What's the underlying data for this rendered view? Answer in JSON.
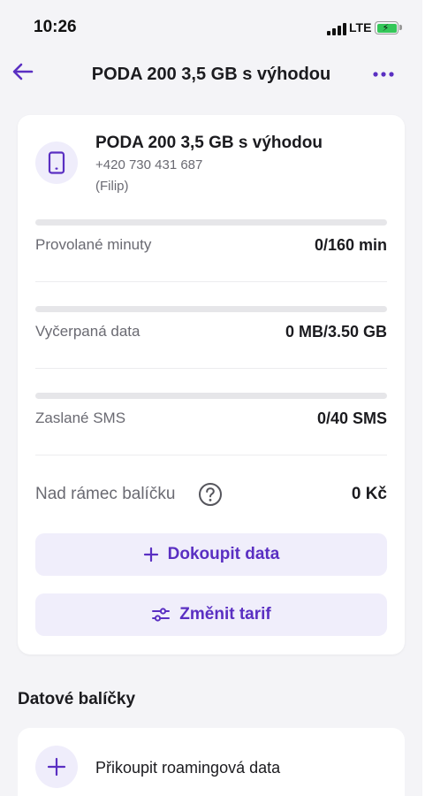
{
  "status_bar": {
    "time": "10:26",
    "network": "LTE",
    "battery_charging": true
  },
  "header": {
    "title": "PODA 200 3,5 GB s výhodou",
    "back_icon": "arrow-left-icon",
    "more_icon": "more-horizontal-icon"
  },
  "plan": {
    "name": "PODA 200 3,5 GB s výhodou",
    "phone": "+420 730 431 687",
    "owner": "(Filip)",
    "icon": "phone-device-icon"
  },
  "usage": [
    {
      "label": "Provolané minuty",
      "value": "0/160 min",
      "fraction": 0
    },
    {
      "label": "Vyčerpaná data",
      "value": "0 MB/3.50 GB",
      "fraction": 0
    },
    {
      "label": "Zaslané SMS",
      "value": "0/40 SMS",
      "fraction": 0
    }
  ],
  "extra": {
    "label": "Nad rámec balíčku",
    "value": "0 Kč",
    "help_icon": "question-circle-icon"
  },
  "actions": {
    "buy_data_label": "Dokoupit data",
    "change_tariff_label": "Změnit tarif"
  },
  "packages": {
    "section_title": "Datové balíčky",
    "add_roaming_label": "Přikoupit roamingová data"
  },
  "colors": {
    "accent": "#5a2fc2",
    "accent_light": "#f0eefb",
    "background": "#f4f4f7",
    "text_muted": "#6a6a72",
    "bar_track": "#e6e6e9"
  }
}
